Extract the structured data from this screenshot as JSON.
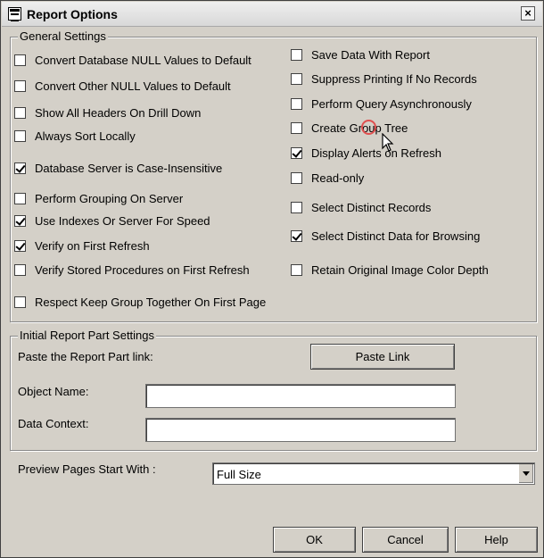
{
  "window": {
    "title": "Report Options",
    "close_glyph": "×"
  },
  "general": {
    "label": "General Settings",
    "left": [
      {
        "label": "Convert Database NULL Values to Default",
        "checked": false
      },
      {
        "label": "Convert Other NULL Values to Default",
        "checked": false
      },
      {
        "label": "Show All Headers On Drill Down",
        "checked": false
      },
      {
        "label": "Always Sort Locally",
        "checked": false
      },
      {
        "label": "Database Server is Case-Insensitive",
        "checked": true
      },
      {
        "label": "Perform Grouping On Server",
        "checked": false
      },
      {
        "label": "Use Indexes Or Server For Speed",
        "checked": true
      },
      {
        "label": "Verify on First Refresh",
        "checked": true
      },
      {
        "label": "Verify Stored Procedures on First Refresh",
        "checked": false
      },
      {
        "label": "Respect Keep Group Together On First Page",
        "checked": false
      }
    ],
    "right": [
      {
        "label": "Save Data With Report",
        "checked": false
      },
      {
        "label": "Suppress Printing If No Records",
        "checked": false
      },
      {
        "label": "Perform Query Asynchronously",
        "checked": false
      },
      {
        "label": "Create Group Tree",
        "checked": false
      },
      {
        "label": "Display Alerts on Refresh",
        "checked": true
      },
      {
        "label": "Read-only",
        "checked": false
      },
      {
        "label": "Select Distinct Records",
        "checked": false
      },
      {
        "label": "Select Distinct Data for Browsing",
        "checked": true
      },
      {
        "label": "Retain Original Image Color Depth",
        "checked": false
      }
    ]
  },
  "report_part": {
    "label": "Initial Report Part Settings",
    "paste_label": "Paste the Report Part link:",
    "paste_button": "Paste Link",
    "object_name_label": "Object Name:",
    "object_name_value": "",
    "data_context_label": "Data Context:",
    "data_context_value": ""
  },
  "preview": {
    "label": "Preview Pages Start With :",
    "value": "Full Size"
  },
  "buttons": {
    "ok": "OK",
    "cancel": "Cancel",
    "help": "Help"
  }
}
